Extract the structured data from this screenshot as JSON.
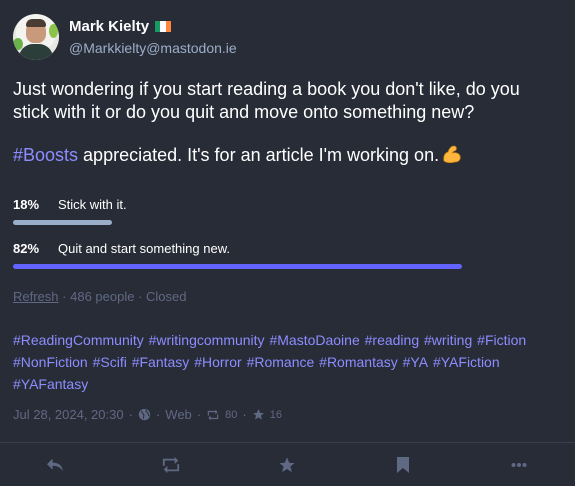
{
  "author": {
    "display_name": "Mark Kielty",
    "flag_emoji": "ireland-flag",
    "handle": "@Markkielty@mastodon.ie"
  },
  "content": {
    "paragraph1": "Just wondering if you start reading a book you don't like, do you stick with it or do you quit and move onto something new?",
    "hashtag_boosts": "#Boosts",
    "paragraph2_rest": " appreciated. It's for an article I'm working on.",
    "emoji": "flexed-biceps"
  },
  "poll": {
    "options": [
      {
        "percent_label": "18%",
        "label": "Stick with it.",
        "fraction": 0.18,
        "leading": false
      },
      {
        "percent_label": "82%",
        "label": "Quit and start something new.",
        "fraction": 0.82,
        "leading": true
      }
    ],
    "refresh_label": "Refresh",
    "voters": "486 people",
    "status": "Closed"
  },
  "hashtags": [
    "#ReadingCommunity",
    "#writingcommunity",
    "#MastoDaoine",
    "#reading",
    "#writing",
    "#Fiction",
    "#NonFiction",
    "#Scifi",
    "#Fantasy",
    "#Horror",
    "#Romance",
    "#Romantasy",
    "#YA",
    "#YAFiction",
    "#YAFantasy"
  ],
  "meta": {
    "timestamp": "Jul 28, 2024, 20:30",
    "visibility_icon": "globe-icon",
    "application": "Web",
    "boost_count": "80",
    "favourite_count": "16"
  },
  "actions": [
    "reply-icon",
    "boost-icon",
    "favourite-icon",
    "bookmark-icon",
    "more-icon"
  ],
  "colors": {
    "background": "#282c37",
    "accent": "#8c8dff",
    "leading_bar": "#6364ff",
    "secondary_text": "#9baec8",
    "muted_text": "#606984",
    "divider": "#393f4f"
  }
}
